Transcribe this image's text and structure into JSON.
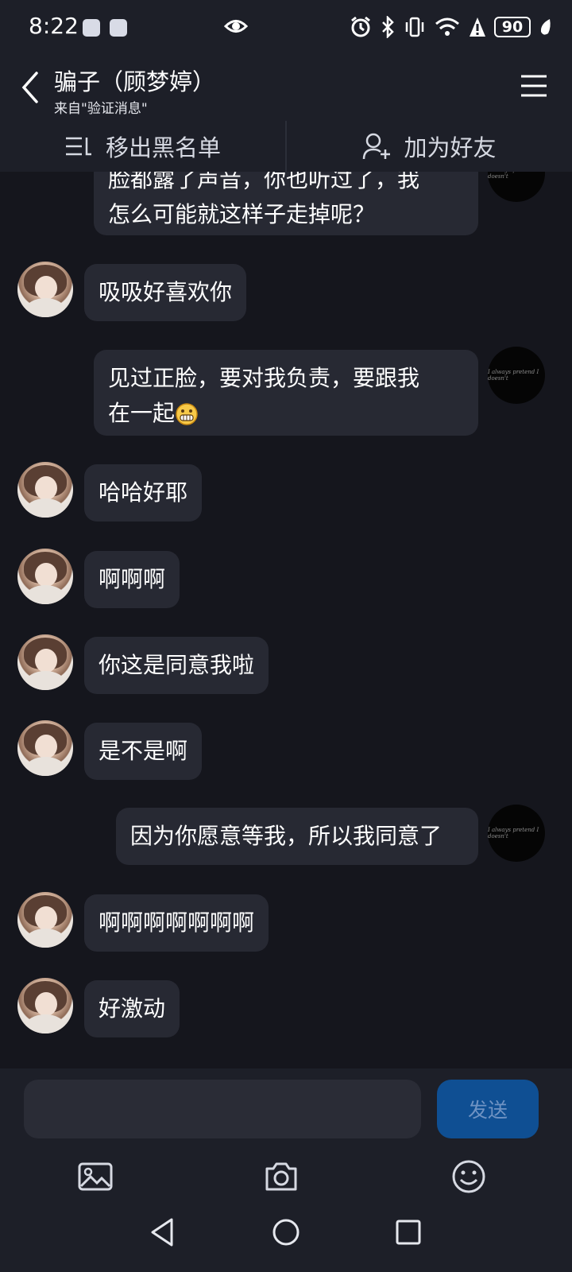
{
  "status_bar": {
    "time": "8:22",
    "battery": "90"
  },
  "header": {
    "title": "骗子（顾梦婷）",
    "subtitle": "来自\"验证消息\""
  },
  "actions": {
    "remove_blacklist": "移出黑名单",
    "add_friend": "加为好友"
  },
  "messages": [
    {
      "sender": "me",
      "text": "脸都露了声音，你也听过了，我\n怎么可能就这样子走掉呢？"
    },
    {
      "sender": "her",
      "text": "吸吸好喜欢你"
    },
    {
      "sender": "me",
      "text": "见过正脸，要对我负责，要跟我\n在一起"
    },
    {
      "sender": "her",
      "text": "哈哈好耶"
    },
    {
      "sender": "her",
      "text": "啊啊啊"
    },
    {
      "sender": "her",
      "text": "你这是同意我啦"
    },
    {
      "sender": "her",
      "text": "是不是啊"
    },
    {
      "sender": "me",
      "text": "因为你愿意等我，所以我同意了"
    },
    {
      "sender": "her",
      "text": "啊啊啊啊啊啊啊"
    },
    {
      "sender": "her",
      "text": "好激动"
    }
  ],
  "my_avatar_text": "I always pretend I doesn't",
  "input": {
    "placeholder": "",
    "send_label": "发送"
  },
  "colors": {
    "background": "#15161d",
    "bar": "#1d1f28",
    "bubble": "#272933",
    "send_button": "#0f4f93"
  }
}
